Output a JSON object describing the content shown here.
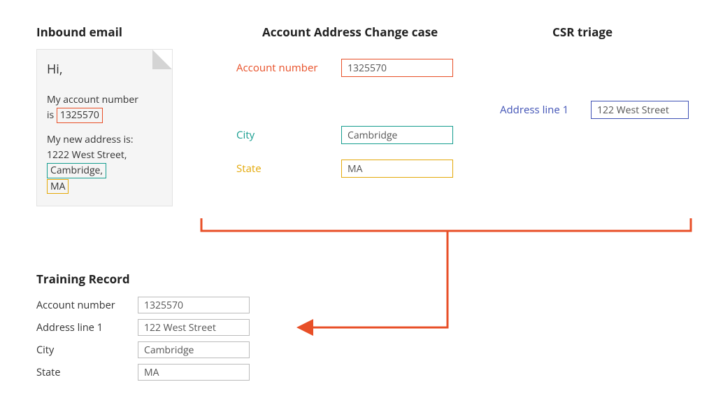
{
  "headings": {
    "inbound": "Inbound email",
    "case": "Account Address Change case",
    "csr": "CSR triage",
    "training": "Training Record"
  },
  "email": {
    "greeting": "Hi,",
    "line1a": "My account number",
    "line1b_prefix": "is ",
    "account_number": "1325570",
    "line2": "My new address is:",
    "street": "1222 West Street,",
    "city": "Cambridge,",
    "state": "MA"
  },
  "case_form": {
    "account_label": "Account number",
    "account_value": "1325570",
    "city_label": "City",
    "city_value": "Cambridge",
    "state_label": "State",
    "state_value": "MA"
  },
  "csr_form": {
    "addr1_label": "Address line 1",
    "addr1_value": "122 West Street"
  },
  "training_form": {
    "account_label": "Account number",
    "account_value": "1325570",
    "addr1_label": "Address line 1",
    "addr1_value": "122 West Street",
    "city_label": "City",
    "city_value": "Cambridge",
    "state_label": "State",
    "state_value": "MA"
  },
  "colors": {
    "orange": "#e84f27",
    "teal": "#159d8f",
    "gold": "#e4a909",
    "blue": "#3f51b5"
  }
}
